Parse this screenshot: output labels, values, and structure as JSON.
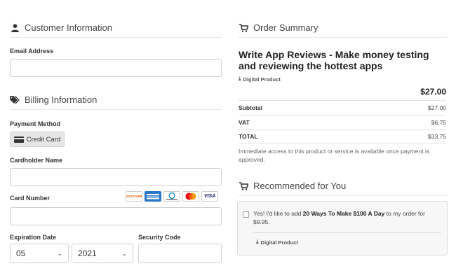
{
  "customer": {
    "heading": "Customer Information",
    "email_label": "Email Address",
    "email_value": ""
  },
  "billing": {
    "heading": "Billing Information",
    "payment_method_label": "Payment Method",
    "credit_card_label": "Credit Card",
    "cardholder_label": "Cardholder Name",
    "cardholder_value": "",
    "card_number_label": "Card Number",
    "card_number_value": "",
    "card_logos": [
      "DISCOVER",
      "AMERICAN EXPRESS",
      "DINERS CLUB",
      "mastercard",
      "VISA"
    ],
    "expiration_label": "Expiration Date",
    "exp_month": "05",
    "exp_year": "2021",
    "security_label": "Security Code",
    "security_value": ""
  },
  "order": {
    "heading": "Order Summary",
    "product_title": "Write App Reviews - Make money testing and reviewing the hottest apps",
    "product_type": "Digital Product",
    "price": "$27.00",
    "rows": [
      {
        "label": "Subtotal",
        "value": "$27.00"
      },
      {
        "label": "VAT",
        "value": "$6.75"
      },
      {
        "label": "TOTAL",
        "value": "$33.75"
      }
    ],
    "note": "Immediate access to this product or service is available once payment is approved."
  },
  "recommended": {
    "heading": "Recommended for You",
    "offer_prefix": "Yes! I'd like to add ",
    "offer_product": "20 Ways To Make $100 A Day",
    "offer_suffix": " to my order for $9.95.",
    "product_type": "Digital Product"
  },
  "colors": {
    "mastercard_red": "#eb001b",
    "mastercard_orange": "#f79e1b",
    "amex_blue": "#2a77c6",
    "visa_navy": "#1a1f71"
  }
}
